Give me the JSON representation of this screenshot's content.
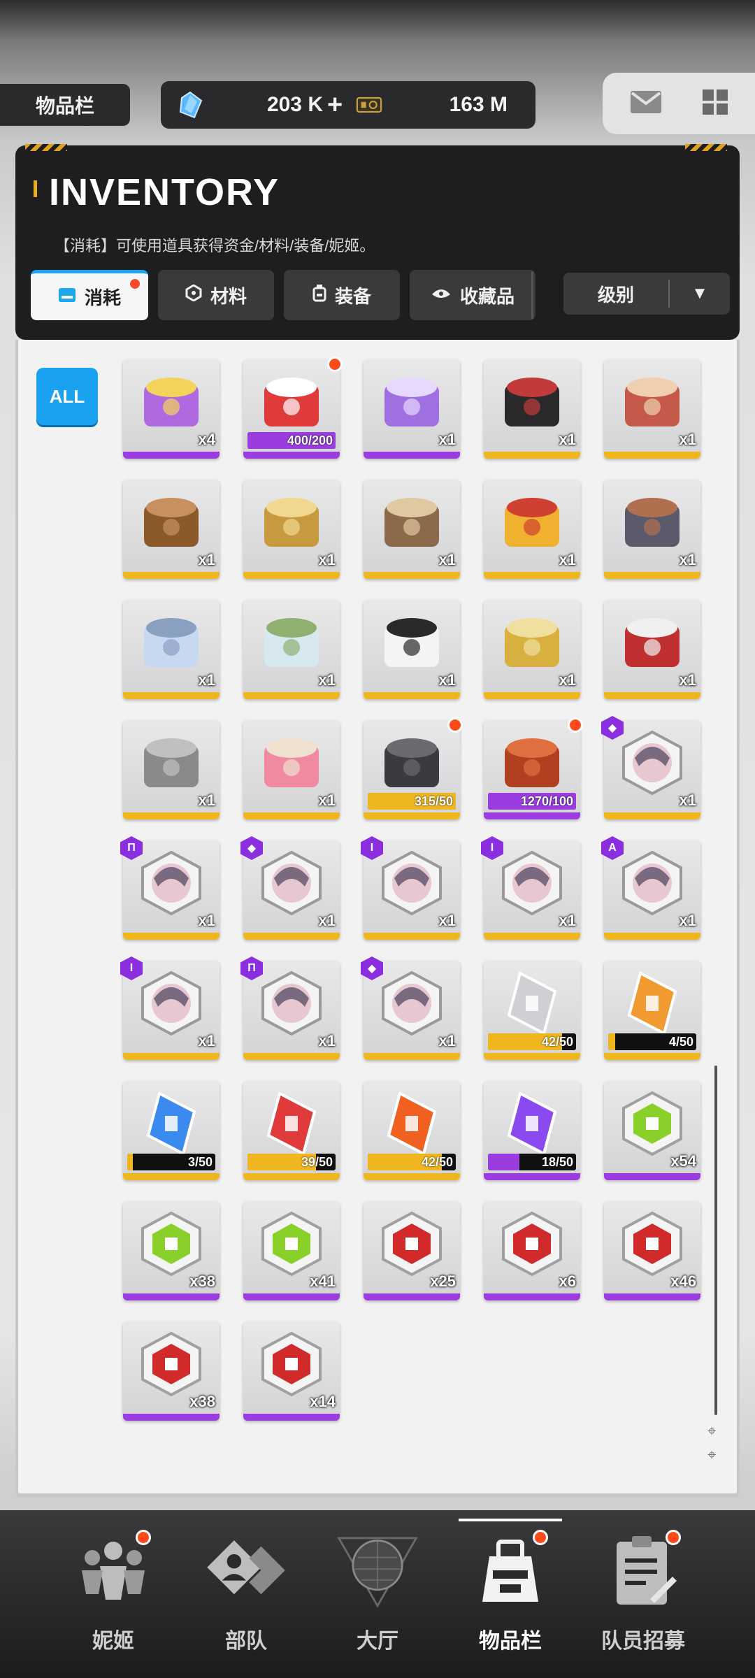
{
  "top": {
    "section_label": "物品栏",
    "gems_value": "203 K",
    "gems_plus": "+",
    "credits_value": "163 M",
    "gem_icon": "crystal-icon",
    "credit_icon": "credit-chip-icon",
    "mail_icon": "mail-icon",
    "menu_icon": "grid-menu-icon"
  },
  "header": {
    "title": "INVENTORY",
    "subtitle": "【消耗】可使用道具获得资金/材料/装备/妮姬。",
    "tabs": [
      {
        "label": "消耗",
        "icon": "consumable-icon",
        "active": true,
        "notif": true
      },
      {
        "label": "材料",
        "icon": "material-icon",
        "active": false,
        "notif": false
      },
      {
        "label": "装备",
        "icon": "equipment-icon",
        "active": false,
        "notif": false
      },
      {
        "label": "收藏品",
        "icon": "collection-icon",
        "active": false,
        "notif": false
      }
    ],
    "sort_label": "级别",
    "sort_arrow": "▼"
  },
  "filter": {
    "all_label": "ALL"
  },
  "items": [
    {
      "name": "gift-box",
      "qty": "x4",
      "rarity": "purple"
    },
    {
      "name": "lucky-box",
      "progress": "400/200",
      "fill": 1.0,
      "fill_color": "#9b3ce0",
      "rarity": "purple",
      "notif": true
    },
    {
      "name": "anniversary-cake",
      "qty": "x1",
      "rarity": "purple"
    },
    {
      "name": "cassette-tape",
      "qty": "x1",
      "rarity": "gold"
    },
    {
      "name": "decorated-cake",
      "qty": "x1",
      "rarity": "gold"
    },
    {
      "name": "woven-basket",
      "qty": "x1",
      "rarity": "gold"
    },
    {
      "name": "medal-badge",
      "qty": "x1",
      "rarity": "gold"
    },
    {
      "name": "birthday-cake",
      "qty": "x1",
      "rarity": "gold"
    },
    {
      "name": "omelette-rice",
      "qty": "x1",
      "rarity": "gold"
    },
    {
      "name": "hot-pot",
      "qty": "x1",
      "rarity": "gold"
    },
    {
      "name": "keychain-a",
      "qty": "x1",
      "rarity": "gold"
    },
    {
      "name": "keychain-b",
      "qty": "x1",
      "rarity": "gold"
    },
    {
      "name": "doodle-paper",
      "qty": "x1",
      "rarity": "gold"
    },
    {
      "name": "gold-can",
      "qty": "x1",
      "rarity": "gold"
    },
    {
      "name": "chef-notebook",
      "qty": "x1",
      "rarity": "gold"
    },
    {
      "name": "stone-statue",
      "qty": "x1",
      "rarity": "gold"
    },
    {
      "name": "strawberry-cake",
      "qty": "x1",
      "rarity": "gold"
    },
    {
      "name": "dark-card",
      "progress": "315/50",
      "fill": 1.0,
      "fill_color": "#f0b620",
      "rarity": "gold",
      "notif": true
    },
    {
      "name": "red-crate",
      "progress": "1270/100",
      "fill": 1.0,
      "fill_color": "#9b3ce0",
      "rarity": "purple",
      "notif": true
    },
    {
      "name": "nikke-token-1",
      "qty": "x1",
      "rarity": "gold",
      "badge": "◆"
    },
    {
      "name": "nikke-token-2",
      "qty": "x1",
      "rarity": "gold",
      "badge": "Π"
    },
    {
      "name": "nikke-token-3",
      "qty": "x1",
      "rarity": "gold",
      "badge": "◆"
    },
    {
      "name": "nikke-token-4",
      "qty": "x1",
      "rarity": "gold",
      "badge": "I"
    },
    {
      "name": "nikke-token-5",
      "qty": "x1",
      "rarity": "gold",
      "badge": "I"
    },
    {
      "name": "nikke-token-6",
      "qty": "x1",
      "rarity": "gold",
      "badge": "A"
    },
    {
      "name": "nikke-token-7",
      "qty": "x1",
      "rarity": "gold",
      "badge": "I"
    },
    {
      "name": "nikke-token-8",
      "qty": "x1",
      "rarity": "gold",
      "badge": "Π"
    },
    {
      "name": "nikke-token-9",
      "qty": "x1",
      "rarity": "gold",
      "badge": "◆"
    },
    {
      "name": "silver-shard",
      "progress": "42/50",
      "fill": 0.84,
      "fill_color": "#f0b620",
      "rarity": "gold"
    },
    {
      "name": "orange-shard",
      "progress": "4/50",
      "fill": 0.08,
      "fill_color": "#f0b620",
      "rarity": "gold"
    },
    {
      "name": "blue-shard",
      "progress": "3/50",
      "fill": 0.06,
      "fill_color": "#f0b620",
      "rarity": "gold"
    },
    {
      "name": "red-shard",
      "progress": "39/50",
      "fill": 0.78,
      "fill_color": "#f0b620",
      "rarity": "gold"
    },
    {
      "name": "fire-shard",
      "progress": "42/50",
      "fill": 0.84,
      "fill_color": "#f0b620",
      "rarity": "gold"
    },
    {
      "name": "purple-shard",
      "progress": "18/50",
      "fill": 0.36,
      "fill_color": "#9b3ce0",
      "rarity": "purple"
    },
    {
      "name": "green-core-star",
      "qty": "x54",
      "rarity": "purple"
    },
    {
      "name": "green-core-shield",
      "qty": "x38",
      "rarity": "purple"
    },
    {
      "name": "green-core-arrow",
      "qty": "x41",
      "rarity": "purple"
    },
    {
      "name": "red-core-diamond",
      "qty": "x25",
      "rarity": "purple"
    },
    {
      "name": "red-core-a",
      "qty": "x6",
      "rarity": "purple"
    },
    {
      "name": "red-core-t",
      "qty": "x46",
      "rarity": "purple"
    },
    {
      "name": "red-core-pi",
      "qty": "x38",
      "rarity": "purple"
    },
    {
      "name": "red-core-grid",
      "qty": "x14",
      "rarity": "purple"
    }
  ],
  "nav": [
    {
      "label": "妮姬",
      "icon": "nikke-group-icon",
      "notif": true,
      "active": false
    },
    {
      "label": "部队",
      "icon": "squad-icon",
      "notif": false,
      "active": false
    },
    {
      "label": "大厅",
      "icon": "lobby-icon",
      "notif": false,
      "active": false
    },
    {
      "label": "物品栏",
      "icon": "inventory-bag-icon",
      "notif": true,
      "active": true
    },
    {
      "label": "队员招募",
      "icon": "recruit-clipboard-icon",
      "notif": true,
      "active": false
    }
  ],
  "colors": {
    "accent_blue": "#1aa2f0",
    "rarity_gold": "#f0b620",
    "rarity_purple": "#9b3ce0",
    "notif_red": "#ff4a1a"
  }
}
